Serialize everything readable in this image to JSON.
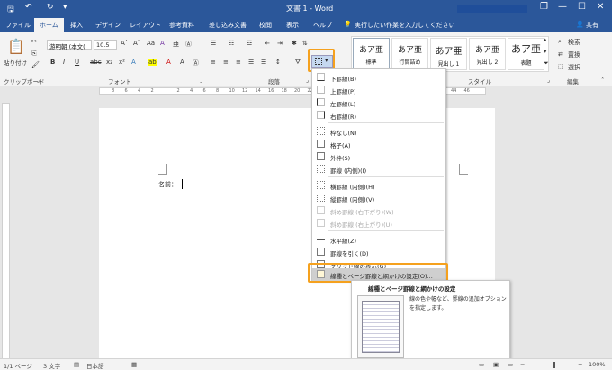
{
  "titlebar": {
    "title": "文書 1  -  Word",
    "restore": "❐",
    "minimize": "—",
    "maximize": "☐",
    "close": "✕"
  },
  "tabs": [
    "ファイル",
    "ホーム",
    "挿入",
    "デザイン",
    "レイアウト",
    "参考資料",
    "差し込み文書",
    "校閲",
    "表示",
    "ヘルプ"
  ],
  "tellme": "実行したい作業を入力してください",
  "share": "共有",
  "ribbon": {
    "paste": "貼り付け",
    "font_name": "游明朝 (本文(",
    "font_size": "10.5",
    "group_clipboard": "クリップボード",
    "group_font": "フォント",
    "group_paragraph": "段落",
    "group_styles": "スタイル",
    "group_edit": "編集",
    "bold": "B",
    "italic": "I",
    "underline": "U",
    "strike": "abc",
    "styles": [
      {
        "sample": "あア亜",
        "name": "標準"
      },
      {
        "sample": "あア亜",
        "name": "行間詰め"
      },
      {
        "sample": "あア亜",
        "name": "見出し 1"
      },
      {
        "sample": "あア亜",
        "name": "見出し 2"
      },
      {
        "sample": "あア亜",
        "name": "表題"
      }
    ],
    "search": "検索",
    "replace": "置換",
    "select": "選択"
  },
  "ruler_ticks": [
    "8",
    "6",
    "4",
    "2",
    "",
    "2",
    "4",
    "6",
    "8",
    "10",
    "12",
    "14",
    "16",
    "18",
    "20",
    "22",
    "24",
    "26",
    "28",
    "30",
    "32",
    "34",
    "36",
    "38",
    "40",
    "42",
    "44",
    "46"
  ],
  "document": {
    "text": "名前："
  },
  "menu": {
    "items": [
      {
        "label": "下罫線(B)",
        "disabled": false
      },
      {
        "label": "上罫線(P)",
        "disabled": false
      },
      {
        "label": "左罫線(L)",
        "disabled": false
      },
      {
        "label": "右罫線(R)",
        "disabled": false
      },
      {
        "label": "枠なし(N)",
        "disabled": false
      },
      {
        "label": "格子(A)",
        "disabled": false
      },
      {
        "label": "外枠(S)",
        "disabled": false
      },
      {
        "label": "罫線 (内側)(I)",
        "disabled": false
      },
      {
        "label": "横罫線 (内側)(H)",
        "disabled": false
      },
      {
        "label": "縦罫線 (内側)(V)",
        "disabled": false
      },
      {
        "label": "斜め罫線 (右下がり)(W)",
        "disabled": true
      },
      {
        "label": "斜め罫線 (右上がり)(U)",
        "disabled": true
      },
      {
        "label": "水平線(Z)",
        "disabled": false
      },
      {
        "label": "罫線を引く(D)",
        "disabled": false
      },
      {
        "label": "グリッド線の表示(G)",
        "disabled": false
      },
      {
        "label": "線種とページ罫線と網かけの設定(O)...",
        "disabled": false
      }
    ]
  },
  "tooltip": {
    "title": "線種とページ罫線と網かけの設定",
    "body": "線の色や幅など、罫線の追加オプションを指定します。"
  },
  "status": {
    "page": "1/1 ページ",
    "words": "3 文字",
    "lang": "日本語",
    "zoom": "100%"
  }
}
